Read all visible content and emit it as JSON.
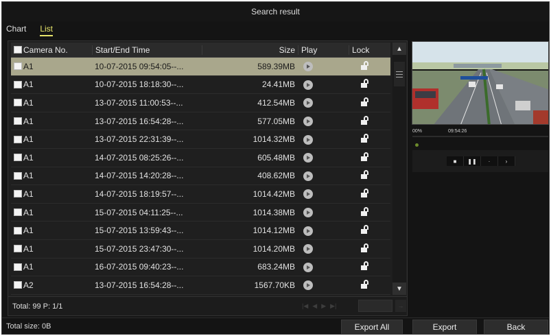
{
  "window": {
    "title": "Search result"
  },
  "tabs": [
    {
      "label": "Chart",
      "active": false
    },
    {
      "label": "List",
      "active": true
    }
  ],
  "table": {
    "headers": {
      "camera": "Camera No.",
      "time": "Start/End Time",
      "size": "Size",
      "play": "Play",
      "lock": "Lock"
    },
    "rows": [
      {
        "camera": "A1",
        "time": "10-07-2015 09:54:05--...",
        "size": "589.39MB",
        "selected": true
      },
      {
        "camera": "A1",
        "time": "10-07-2015 18:18:30--...",
        "size": "24.41MB"
      },
      {
        "camera": "A1",
        "time": "13-07-2015 11:00:53--...",
        "size": "412.54MB"
      },
      {
        "camera": "A1",
        "time": "13-07-2015 16:54:28--...",
        "size": "577.05MB"
      },
      {
        "camera": "A1",
        "time": "13-07-2015 22:31:39--...",
        "size": "1014.32MB"
      },
      {
        "camera": "A1",
        "time": "14-07-2015 08:25:26--...",
        "size": "605.48MB"
      },
      {
        "camera": "A1",
        "time": "14-07-2015 14:20:28--...",
        "size": "408.62MB"
      },
      {
        "camera": "A1",
        "time": "14-07-2015 18:19:57--...",
        "size": "1014.42MB"
      },
      {
        "camera": "A1",
        "time": "15-07-2015 04:11:25--...",
        "size": "1014.38MB"
      },
      {
        "camera": "A1",
        "time": "15-07-2015 13:59:43--...",
        "size": "1014.12MB"
      },
      {
        "camera": "A1",
        "time": "15-07-2015 23:47:30--...",
        "size": "1014.20MB"
      },
      {
        "camera": "A1",
        "time": "16-07-2015 09:40:23--...",
        "size": "683.24MB"
      },
      {
        "camera": "A2",
        "time": "13-07-2015 16:54:28--...",
        "size": "1567.70KB"
      }
    ]
  },
  "footer": {
    "total_label": "Total: 99  P: 1/1"
  },
  "preview": {
    "progress_label": "00%",
    "time": "09:54:26",
    "progress": 0.02
  },
  "bottom": {
    "total_size": "Total size: 0B",
    "export_all": "Export All",
    "export": "Export",
    "back": "Back"
  },
  "colors": {
    "selected_row": "#a9a78c",
    "active_tab": "#e8e56a",
    "background": "#141414"
  },
  "icons": {
    "play": "play-circle-icon",
    "lock": "unlock-icon",
    "scroll_up": "chevron-up-icon",
    "scroll_down": "chevron-down-icon"
  }
}
